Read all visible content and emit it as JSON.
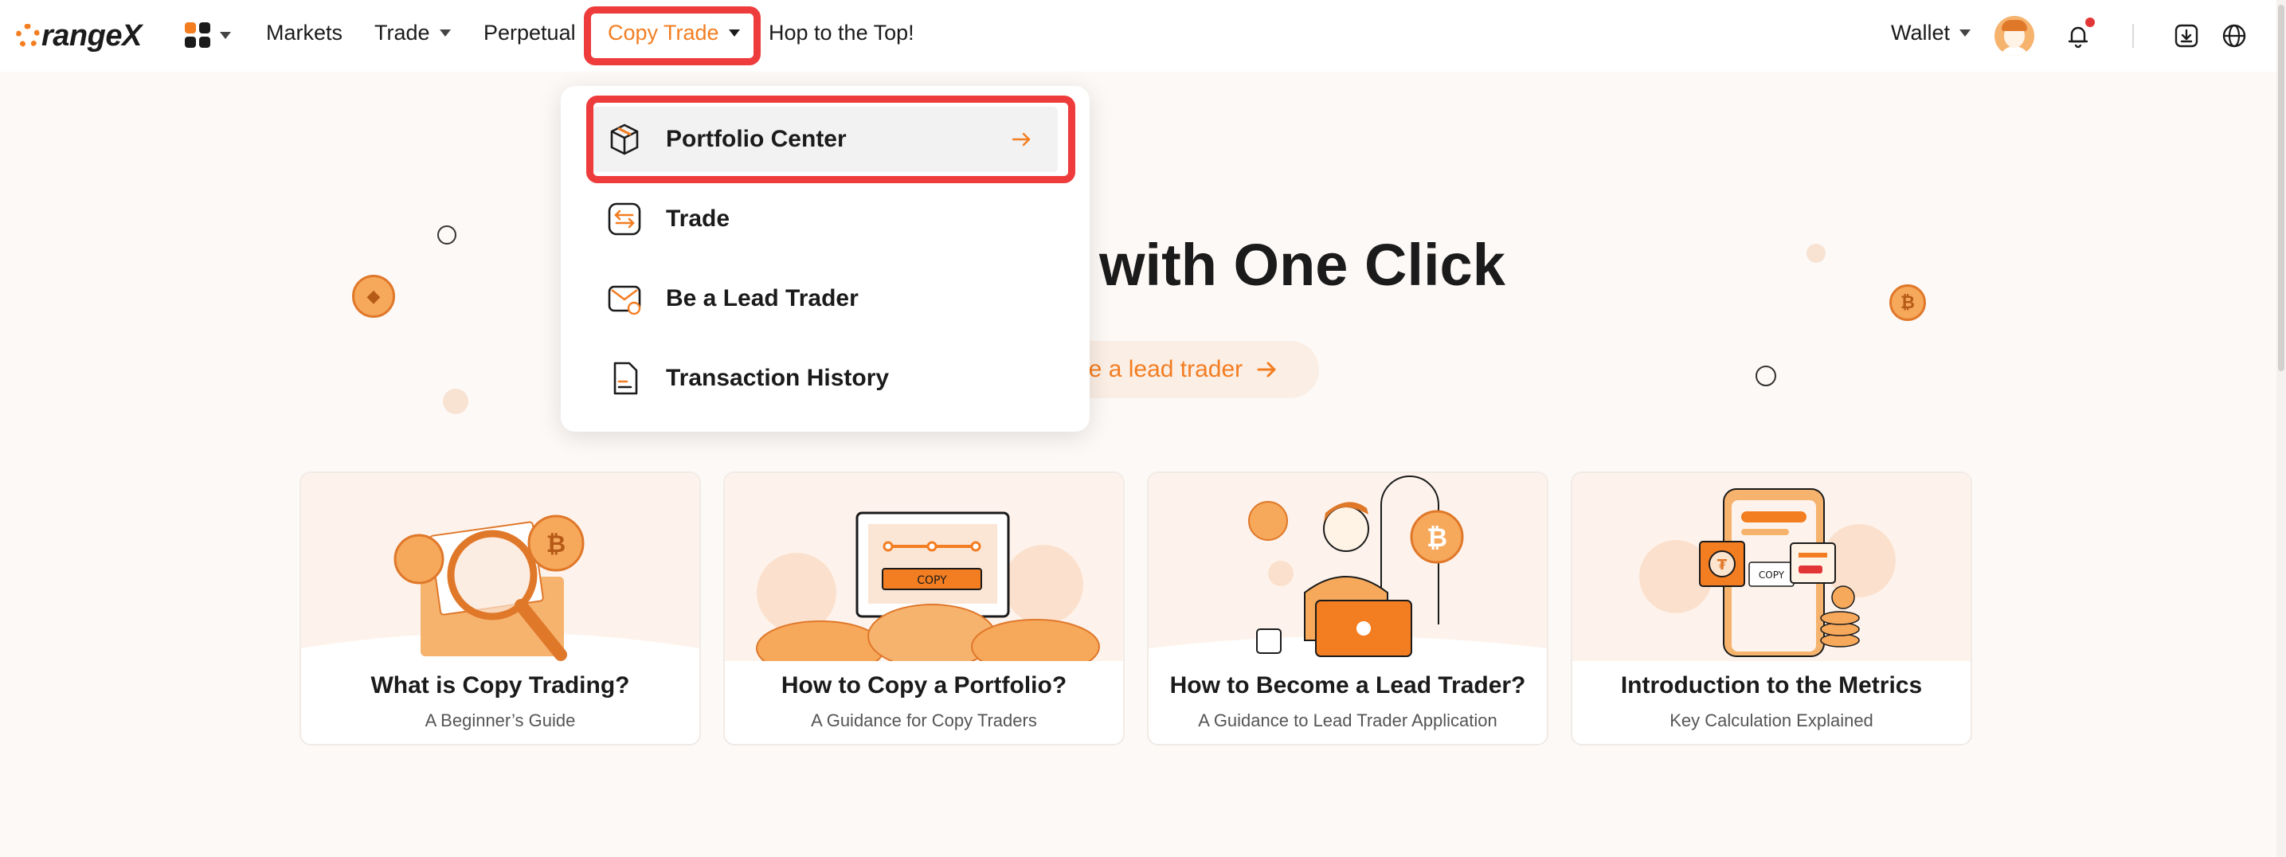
{
  "brand": {
    "logo_text": "rangeX",
    "logo_mark": "O",
    "accent": "#f37d21"
  },
  "nav": {
    "markets": "Markets",
    "trade": "Trade",
    "perpetual": "Perpetual",
    "copy_trade": "Copy Trade",
    "hop": "Hop to the Top!",
    "wallet": "Wallet"
  },
  "dropdown": {
    "items": [
      {
        "label": "Portfolio Center",
        "icon": "cube-icon"
      },
      {
        "label": "Trade",
        "icon": "swap-icon"
      },
      {
        "label": "Be a Lead Trader",
        "icon": "mail-icon"
      },
      {
        "label": "Transaction History",
        "icon": "document-icon"
      }
    ]
  },
  "hero": {
    "title_visible": "with One Click",
    "button_visible": "be a lead trader"
  },
  "cards": [
    {
      "title": "What is Copy Trading?",
      "subtitle": "A Beginner’s Guide"
    },
    {
      "title": "How to Copy a Portfolio?",
      "subtitle": "A Guidance for Copy Traders"
    },
    {
      "title": "How to Become a Lead Trader?",
      "subtitle": "A Guidance to Lead Trader Application"
    },
    {
      "title": "Introduction to the Metrics",
      "subtitle": "Key Calculation Explained"
    }
  ],
  "illustration_text": {
    "copy_label": "COPY"
  },
  "colors": {
    "highlight": "#ee3b3b",
    "accent": "#f37d21",
    "background": "#fdf9f7"
  }
}
